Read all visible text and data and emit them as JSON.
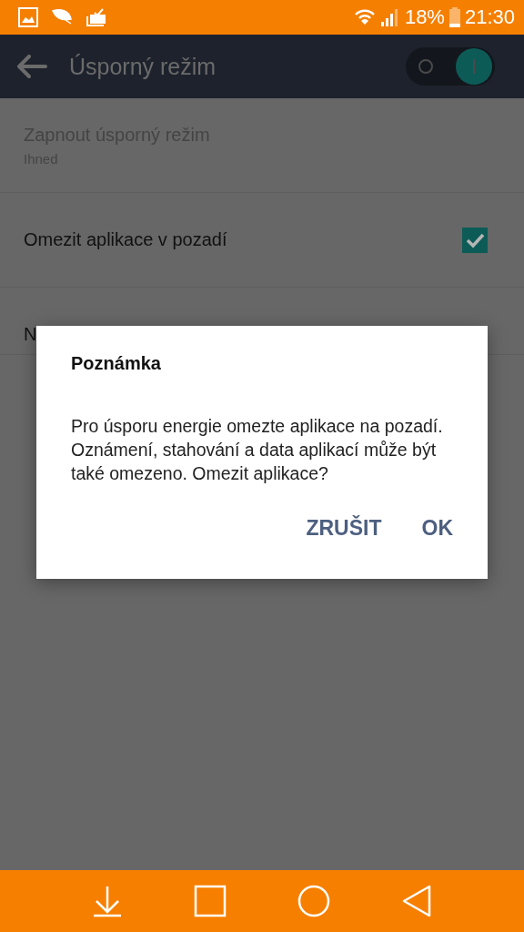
{
  "status_bar": {
    "battery": "18%",
    "time": "21:30"
  },
  "app_bar": {
    "title": "Úsporný režim",
    "switch_on": true
  },
  "settings": [
    {
      "kind": "text",
      "title": "Zapnout úsporný režim",
      "subtitle": "Ihned",
      "disabled": true
    },
    {
      "kind": "checkbox",
      "title": "Omezit aplikace v pozadí",
      "checked": true,
      "disabled": false
    },
    {
      "kind": "text",
      "title": "N",
      "disabled": false
    }
  ],
  "dialog": {
    "title": "Poznámka",
    "message": "Pro úsporu energie omezte aplikace na pozadí. Oznámení, stahování a data aplikací může být také omezeno. Omezit aplikace?",
    "buttons": [
      "ZRUŠIT",
      "OK"
    ]
  }
}
